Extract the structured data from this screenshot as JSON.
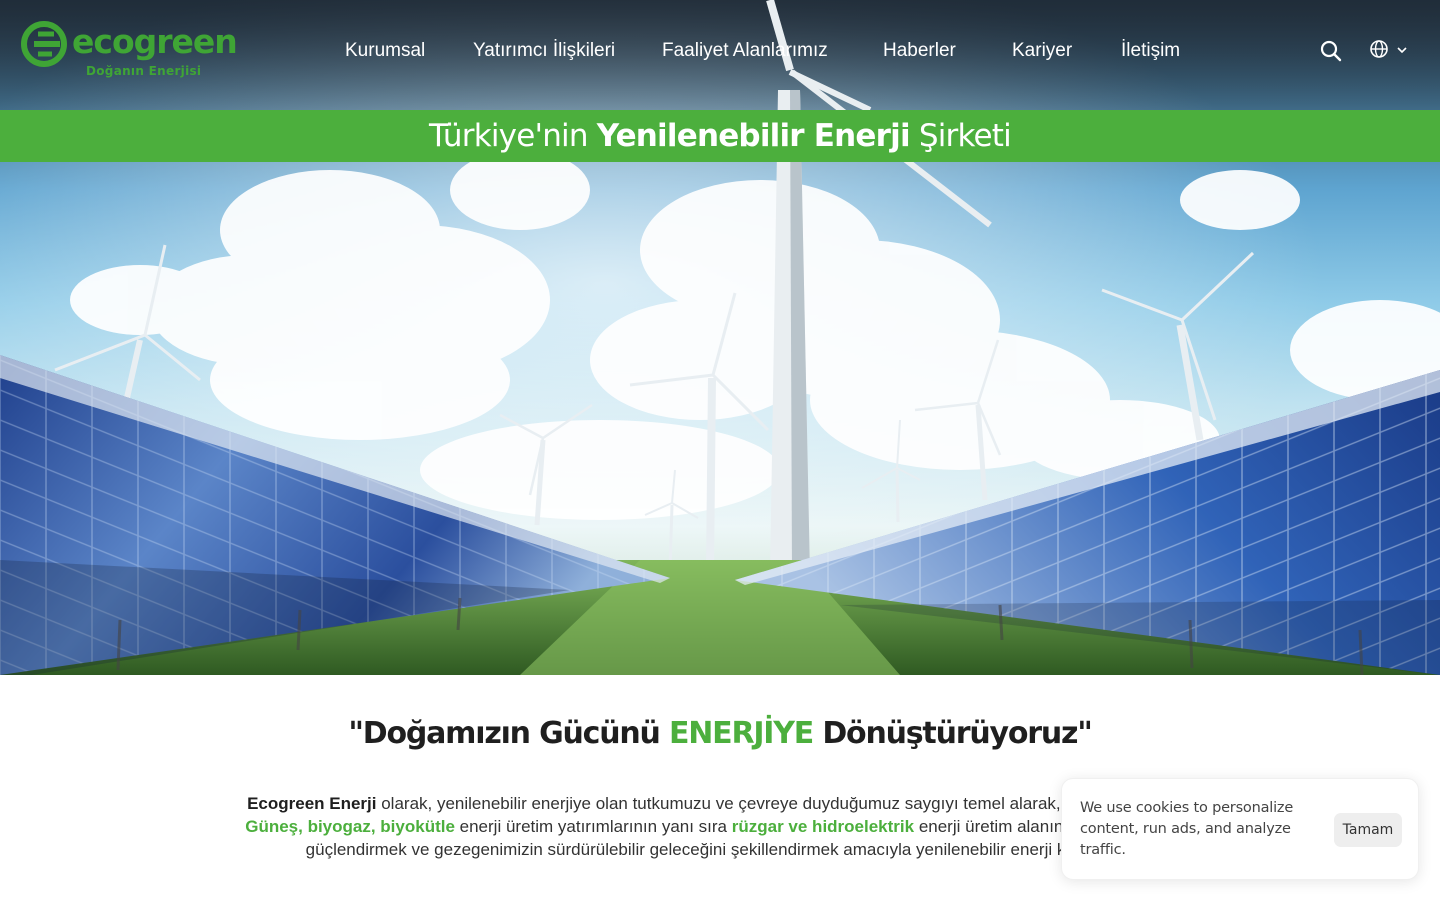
{
  "brand": {
    "name": "ecogreen",
    "tagline": "Doğanın Enerjisi",
    "logo_icon": "ecogreen-e-logo-icon",
    "accent_color": "#4caf3d"
  },
  "nav": {
    "items": [
      {
        "label": "Kurumsal"
      },
      {
        "label": "Yatırımcı İlişkileri"
      },
      {
        "label": "Faaliyet Alanlarımız"
      },
      {
        "label": "Haberler"
      },
      {
        "label": "Kariyer"
      },
      {
        "label": "İletişim"
      }
    ],
    "search_icon": "search-icon",
    "language_icon": "globe-icon"
  },
  "banner": {
    "prefix": "Türkiye'nin ",
    "emphasis": "Yenilenebilir Enerji",
    "suffix": " Şirketi"
  },
  "slogan": {
    "before": "\"Doğamızın Gücünü ",
    "accent": "ENERJİYE",
    "after": " Dönüştürüyoruz\""
  },
  "intro": {
    "line1": {
      "company": "Ecogreen Enerji",
      "text": " olarak, yenilenebilir enerjiye olan tutkumuzu ve çevreye duyduğumuz saygıyı temel alarak, geleceğin enerji i"
    },
    "line2": {
      "hl1": "Güneş, biyogaz, biyokütle",
      "text1": " enerji üretim yatırımlarının yanı sıra ",
      "hl2": "rüzgar ve hidroelektrik",
      "text2": " enerji üretim alanında da projeler gel"
    },
    "line3": {
      "text": "güçlendirmek ve  gezegenimizin sürdürülebilir geleceğini şekillendirmek amacıyla yenilenebilir enerji kaynakları"
    }
  },
  "cookie": {
    "text": "We use cookies to personalize content, run ads, and analyze traffic.",
    "button": "Tamam"
  }
}
